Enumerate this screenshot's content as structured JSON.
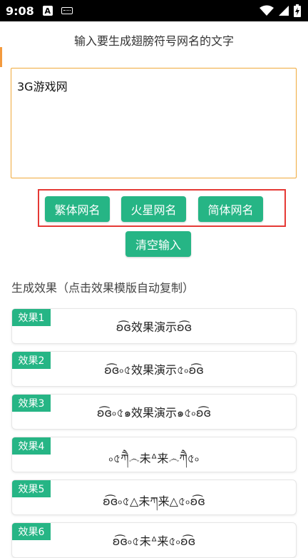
{
  "status_bar": {
    "time": "9:08",
    "notif_letter": "A"
  },
  "prompt_label": "输入要生成翅膀符号网名的文字",
  "input": {
    "value": "3G游戏网"
  },
  "buttons": {
    "traditional": "繁体网名",
    "martian": "火星网名",
    "simplified": "简体网名",
    "clear": "清空输入"
  },
  "results_title": "生成效果（点击效果模版自动复制）",
  "results": [
    {
      "badge": "效果1",
      "text": "ʚ͡ɞ效果演示ʚ͡ɞ"
    },
    {
      "badge": "效果2",
      "text": "ʚ͡ɞ৹৫效果演示৫৹ʚ͡ɞ"
    },
    {
      "badge": "效果3",
      "text": "ʚ͡ɞ৹৫๑效果演示๑৫৹ʚ͡ɞ"
    },
    {
      "badge": "效果4",
      "text": "৹৫ཀཻ෴未ᐞ来෴ཀཻ৫৹"
    },
    {
      "badge": "效果5",
      "text": "ʚ͡ɞ৹৫△未ཀ来△৫৹ʚ͡ɞ"
    },
    {
      "badge": "效果6",
      "text": "ʚ͡ɞ৹৫未ᐞ来৫৹ʚ͡ɞ"
    }
  ]
}
